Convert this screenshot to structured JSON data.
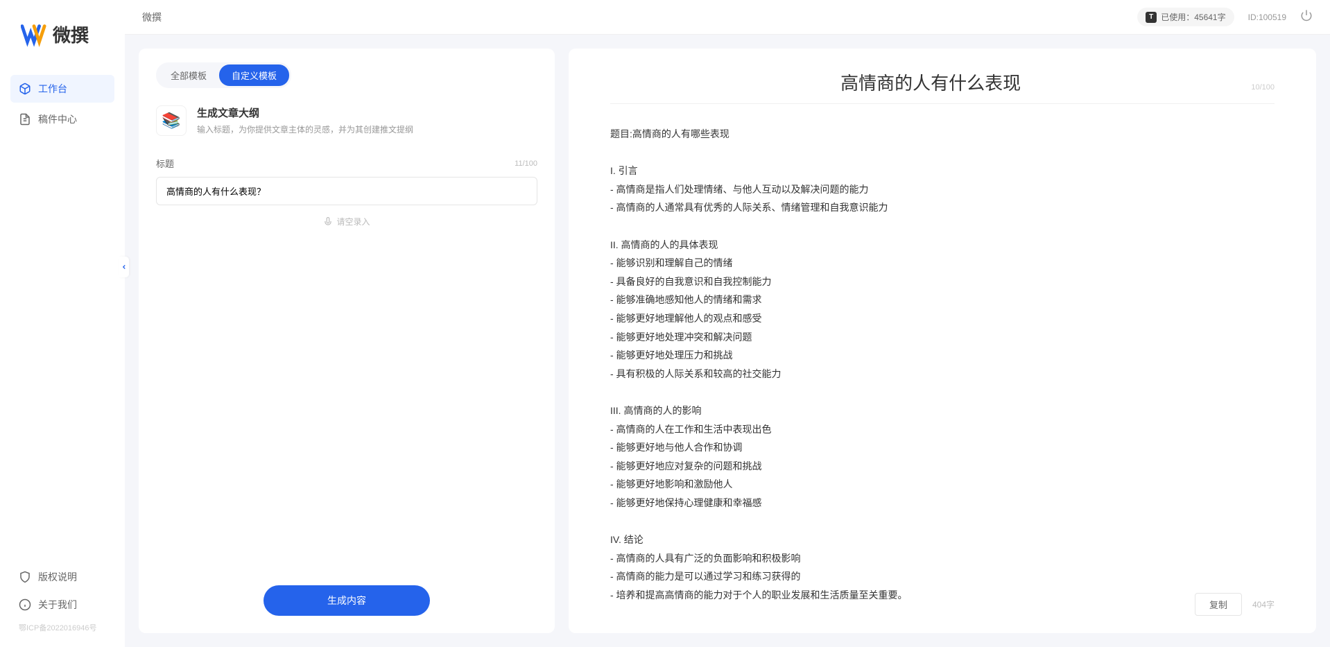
{
  "app": {
    "name": "微撰"
  },
  "topbar": {
    "breadcrumb": "微撰",
    "usage_label": "已使用：45641字",
    "user_id": "ID:100519"
  },
  "sidebar": {
    "nav": [
      {
        "label": "工作台",
        "icon": "cube-icon",
        "active": true
      },
      {
        "label": "稿件中心",
        "icon": "file-icon",
        "active": false
      }
    ],
    "bottom": [
      {
        "label": "版权说明",
        "icon": "shield-icon"
      },
      {
        "label": "关于我们",
        "icon": "info-icon"
      }
    ],
    "icp": "鄂ICP备2022016946号"
  },
  "left_panel": {
    "tabs": [
      {
        "label": "全部模板",
        "active": false
      },
      {
        "label": "自定义模板",
        "active": true
      }
    ],
    "template": {
      "title": "生成文章大纲",
      "desc": "输入标题，为你提供文章主体的灵感，并为其创建推文提纲"
    },
    "form": {
      "title_label": "标题",
      "title_value": "高情商的人有什么表现？",
      "title_count": "11/100",
      "voice_hint": "请空录入"
    },
    "generate_btn": "生成内容"
  },
  "right_panel": {
    "title": "高情商的人有什么表现",
    "title_count": "10/100",
    "body": "题目:高情商的人有哪些表现\n\nI. 引言\n- 高情商是指人们处理情绪、与他人互动以及解决问题的能力\n- 高情商的人通常具有优秀的人际关系、情绪管理和自我意识能力\n\nII. 高情商的人的具体表现\n- 能够识别和理解自己的情绪\n- 具备良好的自我意识和自我控制能力\n- 能够准确地感知他人的情绪和需求\n- 能够更好地理解他人的观点和感受\n- 能够更好地处理冲突和解决问题\n- 能够更好地处理压力和挑战\n- 具有积极的人际关系和较高的社交能力\n\nIII. 高情商的人的影响\n- 高情商的人在工作和生活中表现出色\n- 能够更好地与他人合作和协调\n- 能够更好地应对复杂的问题和挑战\n- 能够更好地影响和激励他人\n- 能够更好地保持心理健康和幸福感\n\nIV. 结论\n- 高情商的人具有广泛的负面影响和积极影响\n- 高情商的能力是可以通过学习和练习获得的\n- 培养和提高高情商的能力对于个人的职业发展和生活质量至关重要。",
    "copy_btn": "复制",
    "word_count": "404字"
  }
}
